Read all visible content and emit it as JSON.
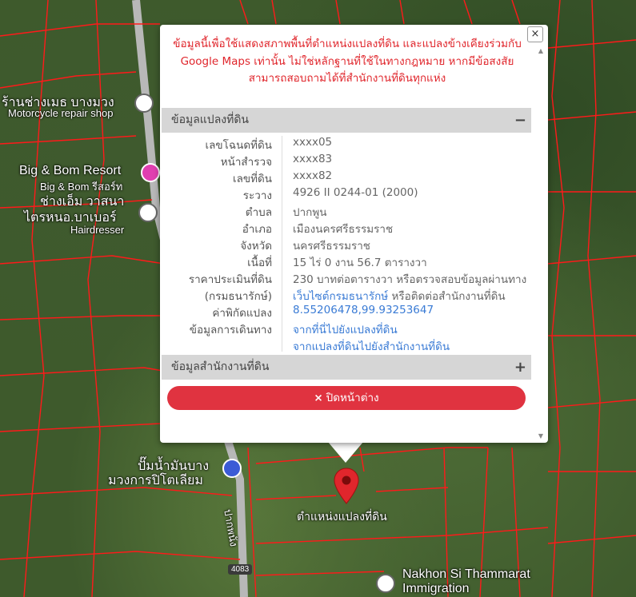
{
  "map": {
    "labels": {
      "moto_shop_th": "ร้านช่างเมธ บางมวง",
      "moto_shop_en": "Motorcycle repair shop",
      "resort_en": "Big & Bom Resort",
      "resort_th": "Big & Bom รีสอร์ท",
      "barber_th_1": "ช่างเอ็ม วาสนา",
      "barber_th_2": "ไตรหนอ.บาเบอร์",
      "barber_en": "Hairdresser",
      "gas_th_1": "ปั๊มน้ำมันบาง",
      "gas_th_2": "มวงการปิโตเลียม",
      "road_th": "ปากพนัง",
      "road_shield": "4083",
      "immigration_1": "Nakhon Si Thammarat",
      "immigration_2": "Immigration",
      "marker_label": "ตำแหน่งแปลงที่ดิน"
    }
  },
  "popup": {
    "disclaimer": "ข้อมูลนี้เพื่อใช้แสดงสภาพพื้นที่ตำแหน่งแปลงที่ดิน และแปลงข้างเคียงร่วมกับ Google Maps เท่านั้น ไม่ใช่หลักฐานที่ใช้ในทางกฎหมาย หากมีข้อสงสัยสามารถสอบถามได้ที่สำนักงานที่ดินทุกแห่ง",
    "close_symbol": "×",
    "section1": {
      "title": "ข้อมูลแปลงที่ดิน",
      "toggle": "−"
    },
    "rows": [
      {
        "key": "เลขโฉนดที่ดิน",
        "value": "xxxx05",
        "link": false
      },
      {
        "key": "หน้าสำรวจ",
        "value": "xxxx83",
        "link": false
      },
      {
        "key": "เลขที่ดิน",
        "value": "xxxx82",
        "link": false
      },
      {
        "key": "ระวาง",
        "value": "4926 II 0244-01 (2000)",
        "link": false
      },
      {
        "key": "ตำบล",
        "value": "ปากพูน",
        "link": false
      },
      {
        "key": "อำเภอ",
        "value": "เมืองนครศรีธรรมราช",
        "link": false
      },
      {
        "key": "จังหวัด",
        "value": "นครศรีธรรมราช",
        "link": false
      },
      {
        "key": "เนื้อที่",
        "value": "15 ไร่ 0 งาน 56.7 ตารางวา",
        "link": false
      },
      {
        "key": "ราคาประเมินที่ดิน",
        "value": "230 บาทต่อตารางวา หรือตรวจสอบข้อมูลผ่านทาง",
        "link": false
      },
      {
        "key": "(กรมธนารักษ์)",
        "value_link": "เว็บไซต์กรมธนารักษ์",
        "value_rest": " หรือติดต่อสำนักงานที่ดิน"
      },
      {
        "key": "ค่าพิกัดแปลง",
        "value": "8.55206478,99.93253647",
        "link": true
      },
      {
        "key": "ข้อมูลการเดินทาง",
        "value": "จากที่นี่ไปยังแปลงที่ดิน",
        "link": true
      },
      {
        "key": "",
        "value": "จากแปลงที่ดินไปยังสำนักงานที่ดิน",
        "link": true
      }
    ],
    "section2": {
      "title": "ข้อมูลสำนักงานที่ดิน",
      "toggle": "+"
    },
    "close_button": "ปิดหน้าต่าง",
    "close_button_icon": "×"
  },
  "colors": {
    "parcel_line": "#ff1a1a",
    "accent": "#e03340",
    "link": "#3a7bd5",
    "disclaimer": "#e0262c"
  }
}
